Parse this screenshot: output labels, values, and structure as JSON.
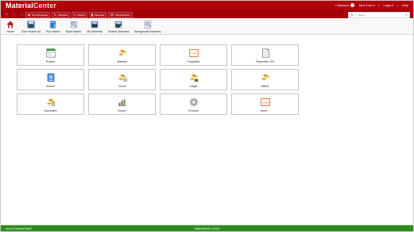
{
  "app": {
    "brand_primary": "Material",
    "brand_secondary": "Center",
    "accent_color": "#b2000b",
    "status_color": "#2e8b1d"
  },
  "topbar": {
    "clipboard_label": "Clipboard",
    "clipboard_count": "0",
    "user_label": "John Doe",
    "logout_label": "Logout",
    "help_label": "Help",
    "separator": "|"
  },
  "navigation": {
    "home_icon": "home-icon",
    "back_icon": "back-icon",
    "forward_icon": "forward-icon",
    "tabs": [
      {
        "label": "My Workspace",
        "icon": "folder-icon"
      },
      {
        "label": "Navigate",
        "icon": "navigate-icon"
      },
      {
        "label": "Search",
        "icon": "search-icon"
      },
      {
        "label": "Materials",
        "icon": "materials-icon"
      },
      {
        "label": "Administration",
        "icon": "administration-icon"
      }
    ],
    "search_placeholder": "Search"
  },
  "toolbar": [
    {
      "label": "Home",
      "icon": "home-icon"
    },
    {
      "label": "Save Search As",
      "icon": "save-icon"
    },
    {
      "label": "Run Search",
      "icon": "run-search-icon"
    },
    {
      "label": "Build Search",
      "icon": "build-search-icon"
    },
    {
      "label": "My Searches",
      "icon": "my-searches-icon"
    },
    {
      "label": "Shared Searches",
      "icon": "shared-searches-icon"
    },
    {
      "label": "Background Searches",
      "icon": "background-searches-icon"
    }
  ],
  "tiles": [
    {
      "label": "Project",
      "icon": "project-icon"
    },
    {
      "label": "Material",
      "icon": "material-icon"
    },
    {
      "label": "Properties",
      "icon": "properties-icon",
      "badge": "SOM"
    },
    {
      "label": "Parameter Set",
      "icon": "parameter-set-icon"
    },
    {
      "label": "Source",
      "icon": "source-icon"
    },
    {
      "label": "Curve",
      "icon": "curve-icon"
    },
    {
      "label": "Image",
      "icon": "image-icon"
    },
    {
      "label": "Matrix",
      "icon": "matrix-icon"
    },
    {
      "label": "Document",
      "icon": "document-icon"
    },
    {
      "label": "Report",
      "icon": "report-icon"
    },
    {
      "label": "Process",
      "icon": "process-icon"
    },
    {
      "label": "More...",
      "icon": "more-icon",
      "badge": "SOM"
    }
  ],
  "status": {
    "left": "smoot (FullUserProfile)",
    "center": "MaterialCenter (2013)"
  }
}
